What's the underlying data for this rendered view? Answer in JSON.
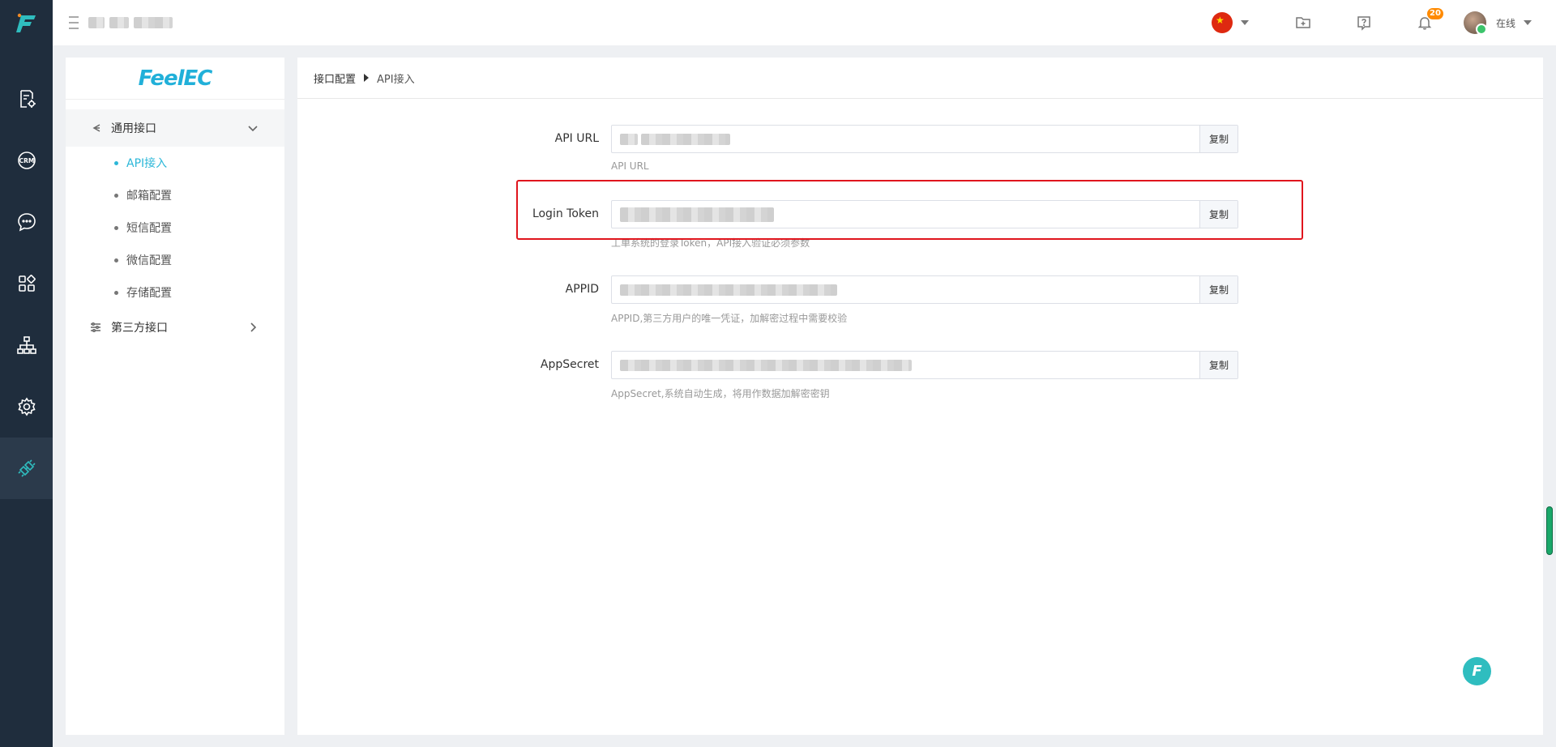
{
  "rail": {
    "logo_letter": "F",
    "items": [
      {
        "name": "rail-ticket-settings",
        "icon": "document-gear-icon"
      },
      {
        "name": "rail-crm",
        "icon": "crm-icon",
        "text": "CRM"
      },
      {
        "name": "rail-chat",
        "icon": "chat-bubble-icon"
      },
      {
        "name": "rail-apps",
        "icon": "grid-apps-icon"
      },
      {
        "name": "rail-org",
        "icon": "org-chart-icon"
      },
      {
        "name": "rail-settings",
        "icon": "gear-icon"
      },
      {
        "name": "rail-integration",
        "icon": "plug-link-icon",
        "active": true
      }
    ]
  },
  "topbar": {
    "notifications_count": "20",
    "user_status": "在线"
  },
  "subnav": {
    "logo_text": "FeelEC",
    "group_general": "通用接口",
    "items": [
      {
        "label": "API接入",
        "active": true
      },
      {
        "label": "邮箱配置"
      },
      {
        "label": "短信配置"
      },
      {
        "label": "微信配置"
      },
      {
        "label": "存储配置"
      }
    ],
    "group_third_party": "第三方接口"
  },
  "breadcrumb": {
    "parent": "接口配置",
    "current": "API接入"
  },
  "form": {
    "copy_label": "复制",
    "fields": [
      {
        "label": "API URL",
        "hint": "API URL"
      },
      {
        "label": "Login Token",
        "hint": "工单系统的登录Token，API接入验证必须参数"
      },
      {
        "label": "APPID",
        "hint": "APPID,第三方用户的唯一凭证，加解密过程中需要校验"
      },
      {
        "label": "AppSecret",
        "hint": "AppSecret,系统自动生成，将用作数据加解密密钥"
      }
    ]
  },
  "fab": {
    "letter": "F"
  },
  "colors": {
    "rail_bg": "#1f2d3d",
    "accent": "#2cb7d8",
    "highlight_border": "#e0151d",
    "badge": "#ff8a00"
  }
}
